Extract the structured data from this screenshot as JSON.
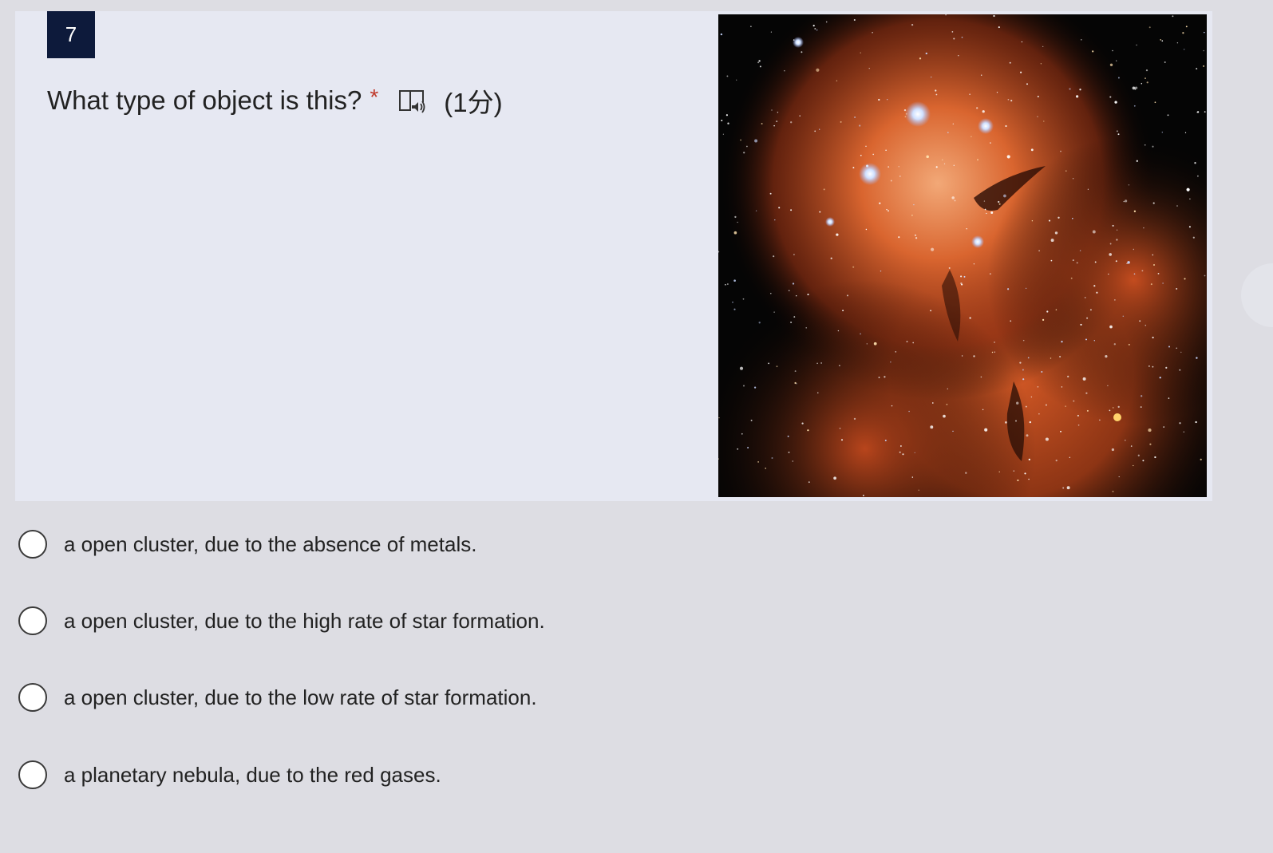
{
  "question": {
    "number": "7",
    "prompt": "What type of object is this?",
    "required_mark": "*",
    "points": "(1分)",
    "reader_icon": "immersive-reader-icon"
  },
  "image": {
    "icon": "nebula-photo",
    "description_colors": {
      "gas": "#c8502a",
      "background": "#050505"
    }
  },
  "options": [
    {
      "label": "a open cluster, due to the absence of metals."
    },
    {
      "label": "a open cluster, due to the high rate of star formation."
    },
    {
      "label": "a open cluster, due to the low rate of star formation."
    },
    {
      "label": "a planetary nebula, due to the red gases."
    }
  ],
  "colors": {
    "page_bg": "#dddde3",
    "card_bg": "#e6e8f2",
    "badge_bg": "#0d1a3b",
    "required": "#c0392b"
  }
}
